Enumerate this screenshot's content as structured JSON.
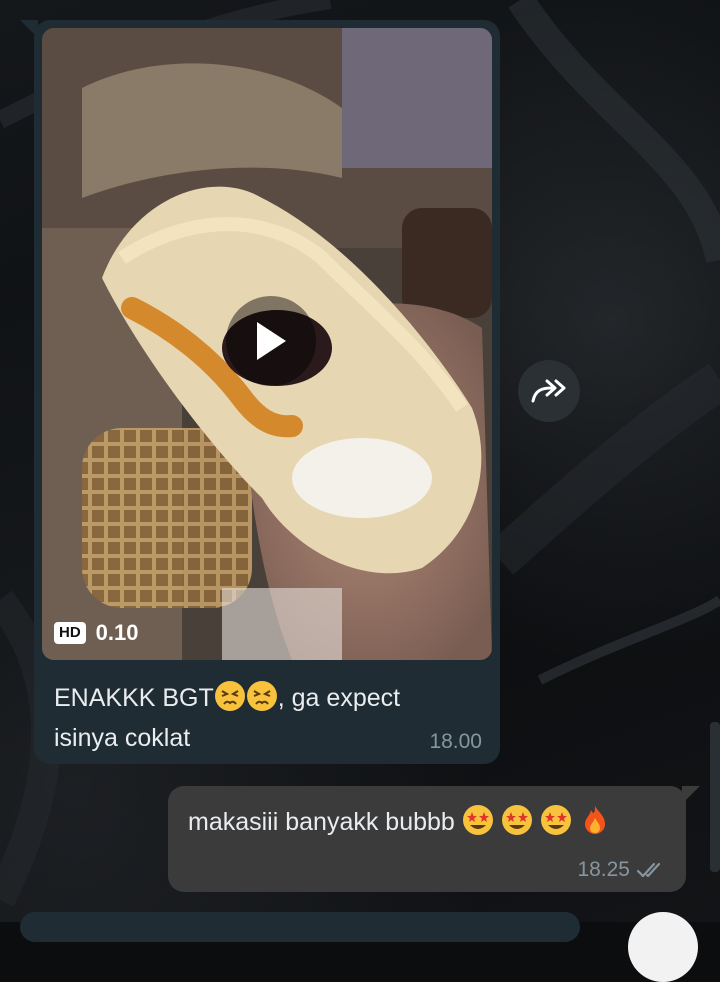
{
  "incoming": {
    "video": {
      "hd_badge": "HD",
      "duration": "0.10"
    },
    "caption_part1": "ENAKKK BGT",
    "caption_part2": ", ga expect",
    "caption_line2": "isinya coklat",
    "caption_emojis": [
      "persevering-face-emoji",
      "persevering-face-emoji"
    ],
    "time": "18.00"
  },
  "outgoing": {
    "text": "makasiii banyakk bubbb",
    "emojis": [
      "star-struck-emoji",
      "star-struck-emoji",
      "star-struck-emoji",
      "fire-emoji"
    ],
    "time": "18.25",
    "status": "read-double-check"
  },
  "icons": {
    "play": "play-icon",
    "forward": "forward-icon",
    "double_check": "double-check-icon"
  },
  "colors": {
    "incoming_bubble": "#1f2c33",
    "outgoing_bubble": "#3b3b3b",
    "timestamp": "#8696a0",
    "text": "#e9edef"
  }
}
